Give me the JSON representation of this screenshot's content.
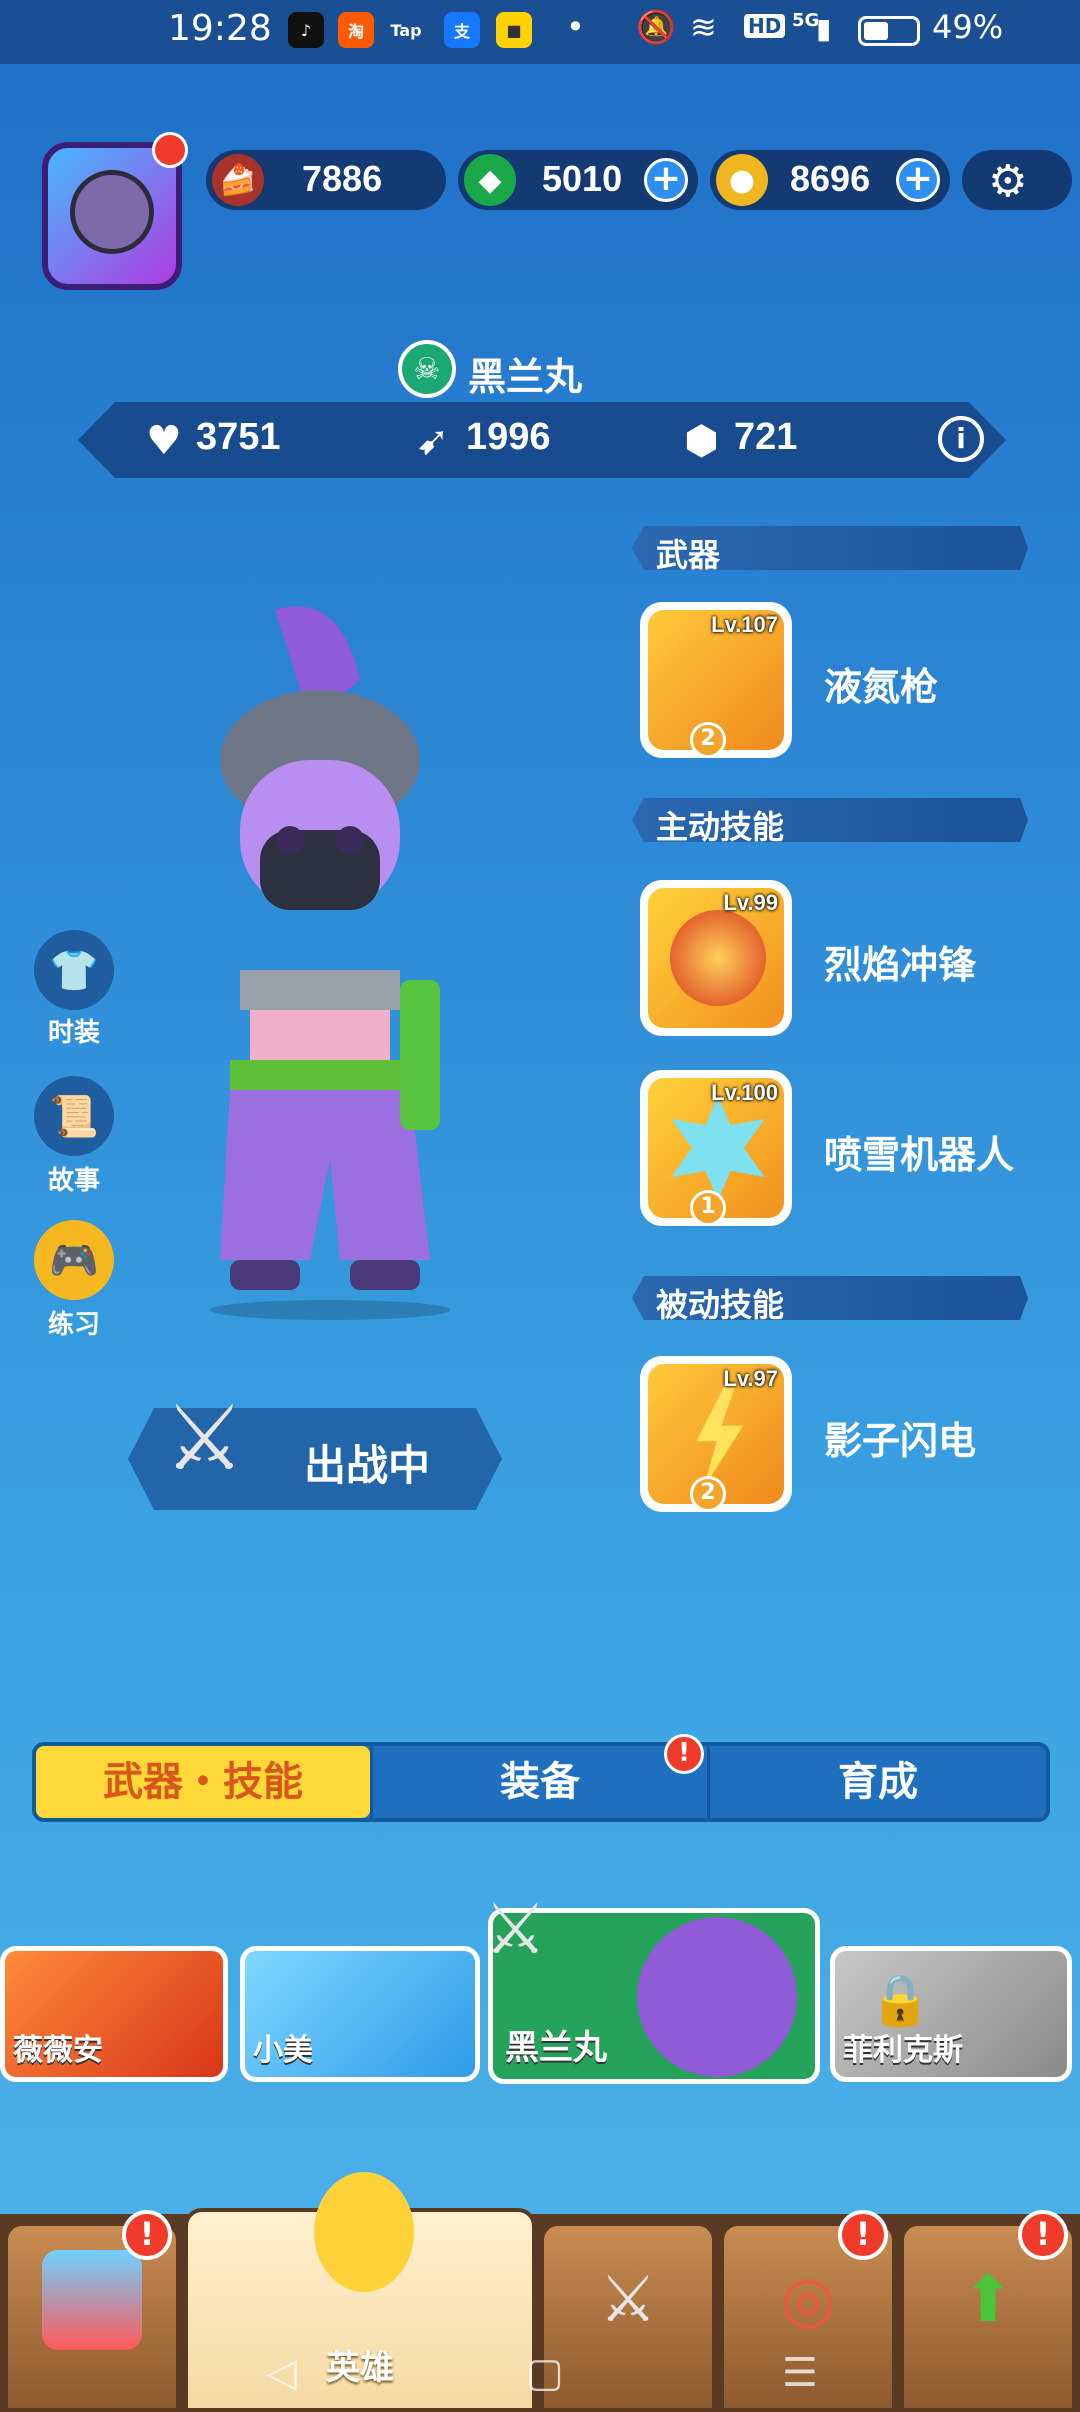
{
  "status_bar": {
    "time": "19:28",
    "network": "5G",
    "battery": "49%",
    "hd": "HD"
  },
  "currencies": {
    "cake": "7886",
    "gems": "5010",
    "coins": "8696"
  },
  "hero": {
    "name": "黑兰丸",
    "health": "3751",
    "attack": "1996",
    "defense": "721"
  },
  "sections": {
    "weapon": "武器",
    "active_skills": "主动技能",
    "passive_skills": "被动技能"
  },
  "skills": [
    {
      "name": "液氮枪",
      "level": "Lv.107",
      "stars": "2"
    },
    {
      "name": "烈焰冲锋",
      "level": "Lv.99",
      "stars": ""
    },
    {
      "name": "喷雪机器人",
      "level": "Lv.100",
      "stars": "1"
    },
    {
      "name": "影子闪电",
      "level": "Lv.97",
      "stars": "2"
    }
  ],
  "side_menu": {
    "costume": "时装",
    "story": "故事",
    "practice": "练习"
  },
  "deploy_status": "出战中",
  "tabs": {
    "weapons_skills": "武器・技能",
    "equipment": "装备",
    "training": "育成"
  },
  "hero_cards": [
    {
      "name": "薇薇安"
    },
    {
      "name": "小美"
    },
    {
      "name": "黑兰丸"
    },
    {
      "name": "菲利克斯"
    }
  ],
  "bottom_nav": {
    "heroes": "英雄"
  },
  "colors": {
    "accent_yellow": "#ffd83a",
    "alert_red": "#f03a2a",
    "panel_blue": "#1f70bf"
  }
}
